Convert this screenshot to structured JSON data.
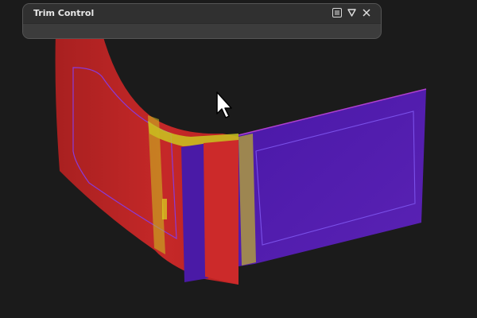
{
  "panel": {
    "title": "Trim Control",
    "buttons": {
      "menu": "menu-icon",
      "collapse": "triangle-down-icon",
      "close": "close-icon"
    }
  },
  "viewport": {
    "background": "#1b1b1b",
    "colors": {
      "red_surface": "#c02a2a",
      "purple_surface": "#4d1ea8",
      "highlight": "#d8d820",
      "edge": "#a030d0"
    }
  }
}
